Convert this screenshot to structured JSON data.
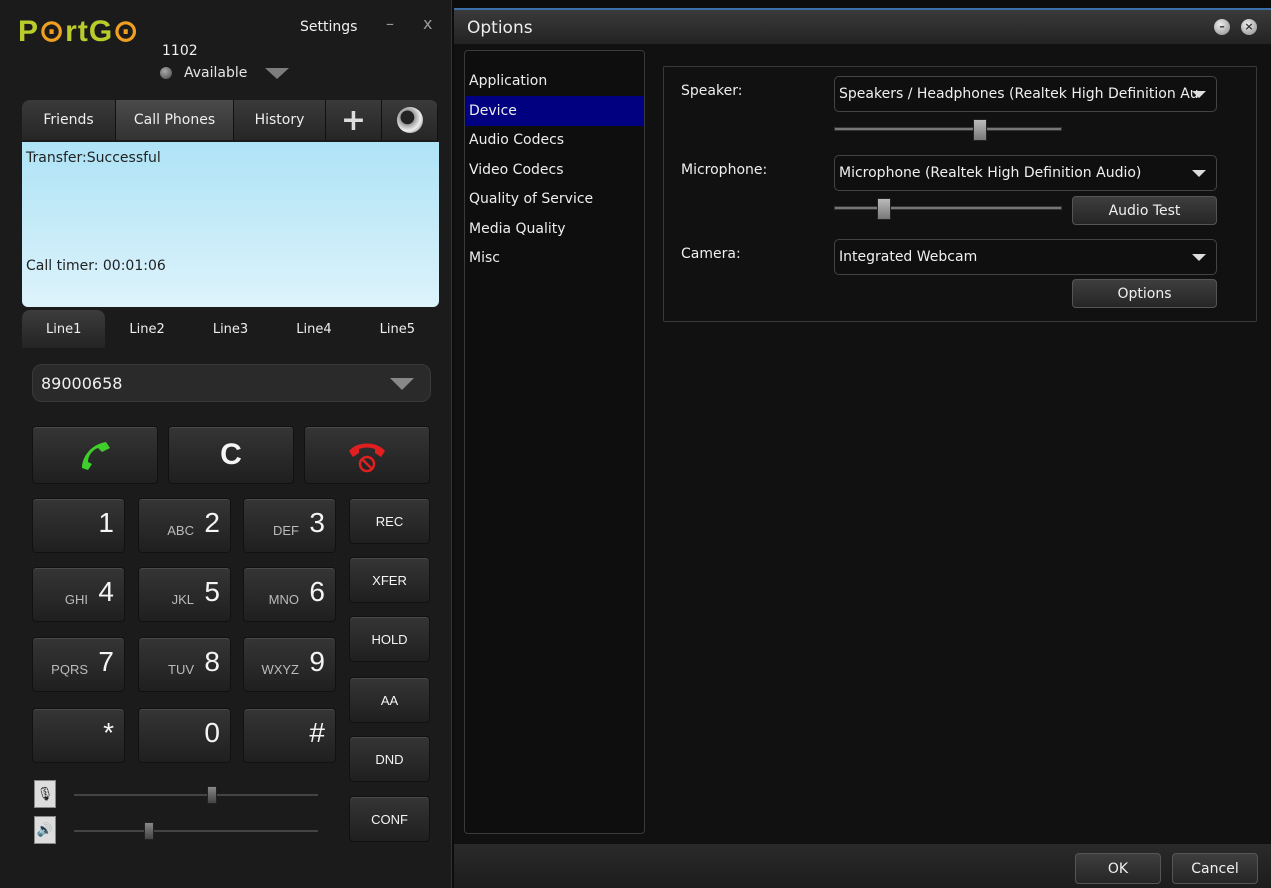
{
  "phone": {
    "logo": "PortGo",
    "extension": "1102",
    "settings_label": "Settings",
    "minimize_glyph": "–",
    "close_glyph": "x",
    "presence": "Available",
    "tabs": {
      "friends": "Friends",
      "call_phones": "Call Phones",
      "history": "History",
      "add": "+"
    },
    "display": {
      "status": "Transfer:Successful",
      "timer": "Call timer: 00:01:06"
    },
    "lines": [
      "Line1",
      "Line2",
      "Line3",
      "Line4",
      "Line5"
    ],
    "number": "89000658",
    "clear_label": "C",
    "keys": [
      {
        "digit": "1",
        "letters": ""
      },
      {
        "digit": "2",
        "letters": "ABC"
      },
      {
        "digit": "3",
        "letters": "DEF"
      },
      {
        "digit": "4",
        "letters": "GHI"
      },
      {
        "digit": "5",
        "letters": "JKL"
      },
      {
        "digit": "6",
        "letters": "MNO"
      },
      {
        "digit": "7",
        "letters": "PQRS"
      },
      {
        "digit": "8",
        "letters": "TUV"
      },
      {
        "digit": "9",
        "letters": "WXYZ"
      },
      {
        "digit": "*",
        "letters": ""
      },
      {
        "digit": "0",
        "letters": ""
      },
      {
        "digit": "#",
        "letters": ""
      }
    ],
    "side_buttons": [
      "REC",
      "XFER",
      "HOLD",
      "AA",
      "DND",
      "CONF"
    ],
    "icons": {
      "answer": "phone-answer-icon",
      "hangup": "phone-hangup-icon",
      "mic": "microphone-icon",
      "speaker": "speaker-icon"
    },
    "mic_volume": 0.57,
    "speaker_volume": 0.3,
    "colors": {
      "answer": "#3fcf2a",
      "hangup": "#e02020",
      "logo": "#b9cc2c"
    }
  },
  "options": {
    "title": "Options",
    "nav": [
      "Application",
      "Device",
      "Audio Codecs",
      "Video Codecs",
      "Quality of Service",
      "Media Quality",
      "Misc"
    ],
    "nav_selected": "Device",
    "device": {
      "speaker_label": "Speaker:",
      "speaker_value": "Speakers / Headphones (Realtek High Definition Au",
      "speaker_volume": 0.65,
      "microphone_label": "Microphone:",
      "microphone_value": "Microphone (Realtek High Definition Audio)",
      "microphone_volume": 0.2,
      "audio_test_label": "Audio Test",
      "camera_label": "Camera:",
      "camera_value": "Integrated Webcam",
      "camera_options_label": "Options"
    },
    "footer": {
      "ok": "OK",
      "cancel": "Cancel"
    },
    "colors": {
      "nav_selected": "#000080",
      "title_accent": "#3c6ea8"
    }
  }
}
